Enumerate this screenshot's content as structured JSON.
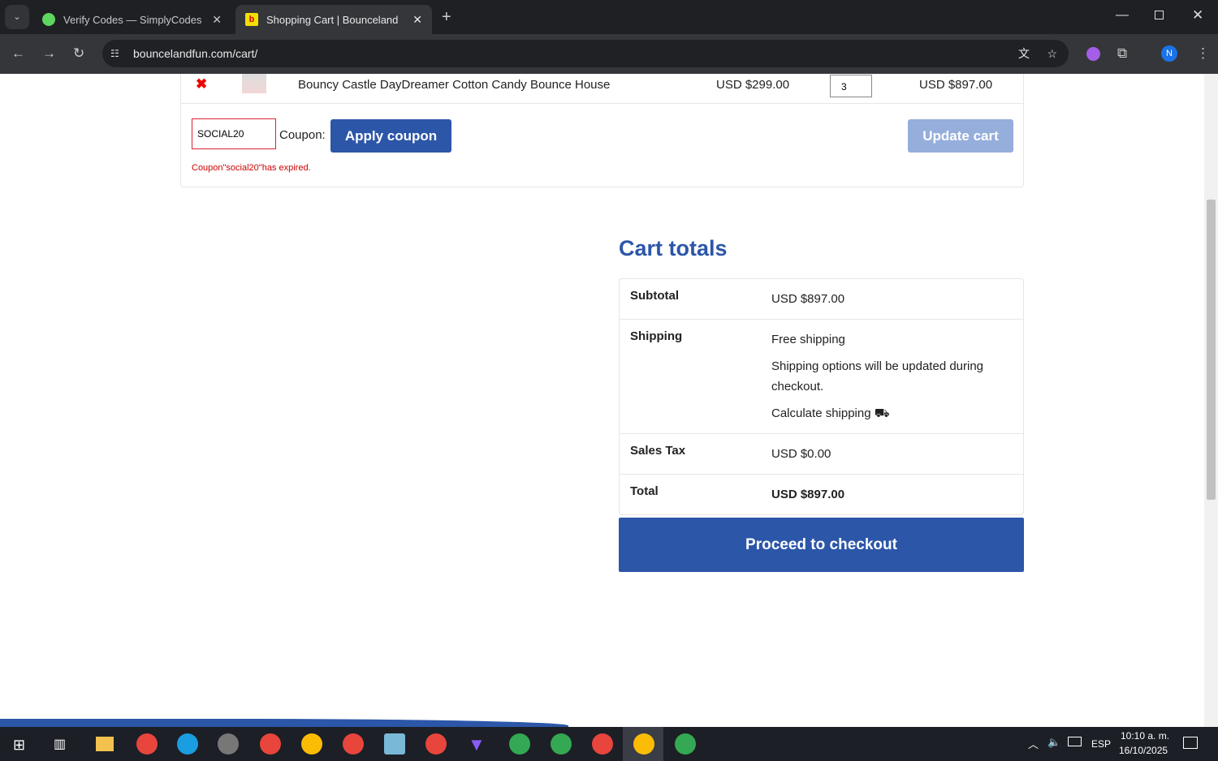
{
  "browser": {
    "tabs": [
      {
        "title": "Verify Codes — SimplyCodes",
        "active": false
      },
      {
        "title": "Shopping Cart | Bounceland",
        "active": true
      }
    ],
    "url": "bouncelandfun.com/cart/",
    "profile_initial": "N"
  },
  "cart": {
    "item": {
      "name": "Bouncy Castle DayDreamer Cotton Candy Bounce House",
      "price": "USD $299.00",
      "quantity": "3",
      "subtotal": "USD $897.00"
    },
    "coupon_value": "SOCIAL20",
    "coupon_label": "Coupon:",
    "apply_label": "Apply coupon",
    "update_label": "Update cart",
    "error": "Coupon\"social20\"has expired."
  },
  "totals": {
    "title": "Cart totals",
    "subtotal_label": "Subtotal",
    "subtotal": "USD $897.00",
    "shipping_label": "Shipping",
    "shipping": "Free shipping",
    "shipping_note": "Shipping options will be updated during checkout.",
    "calc_shipping": "Calculate shipping",
    "tax_label": "Sales Tax",
    "tax": "USD $0.00",
    "total_label": "Total",
    "total": "USD $897.00",
    "checkout_label": "Proceed to checkout"
  },
  "taskbar": {
    "lang": "ESP",
    "time": "10:10 a. m.",
    "date": "16/10/2025"
  },
  "colors": {
    "accent": "#2c56a8",
    "error": "#cc0000"
  }
}
